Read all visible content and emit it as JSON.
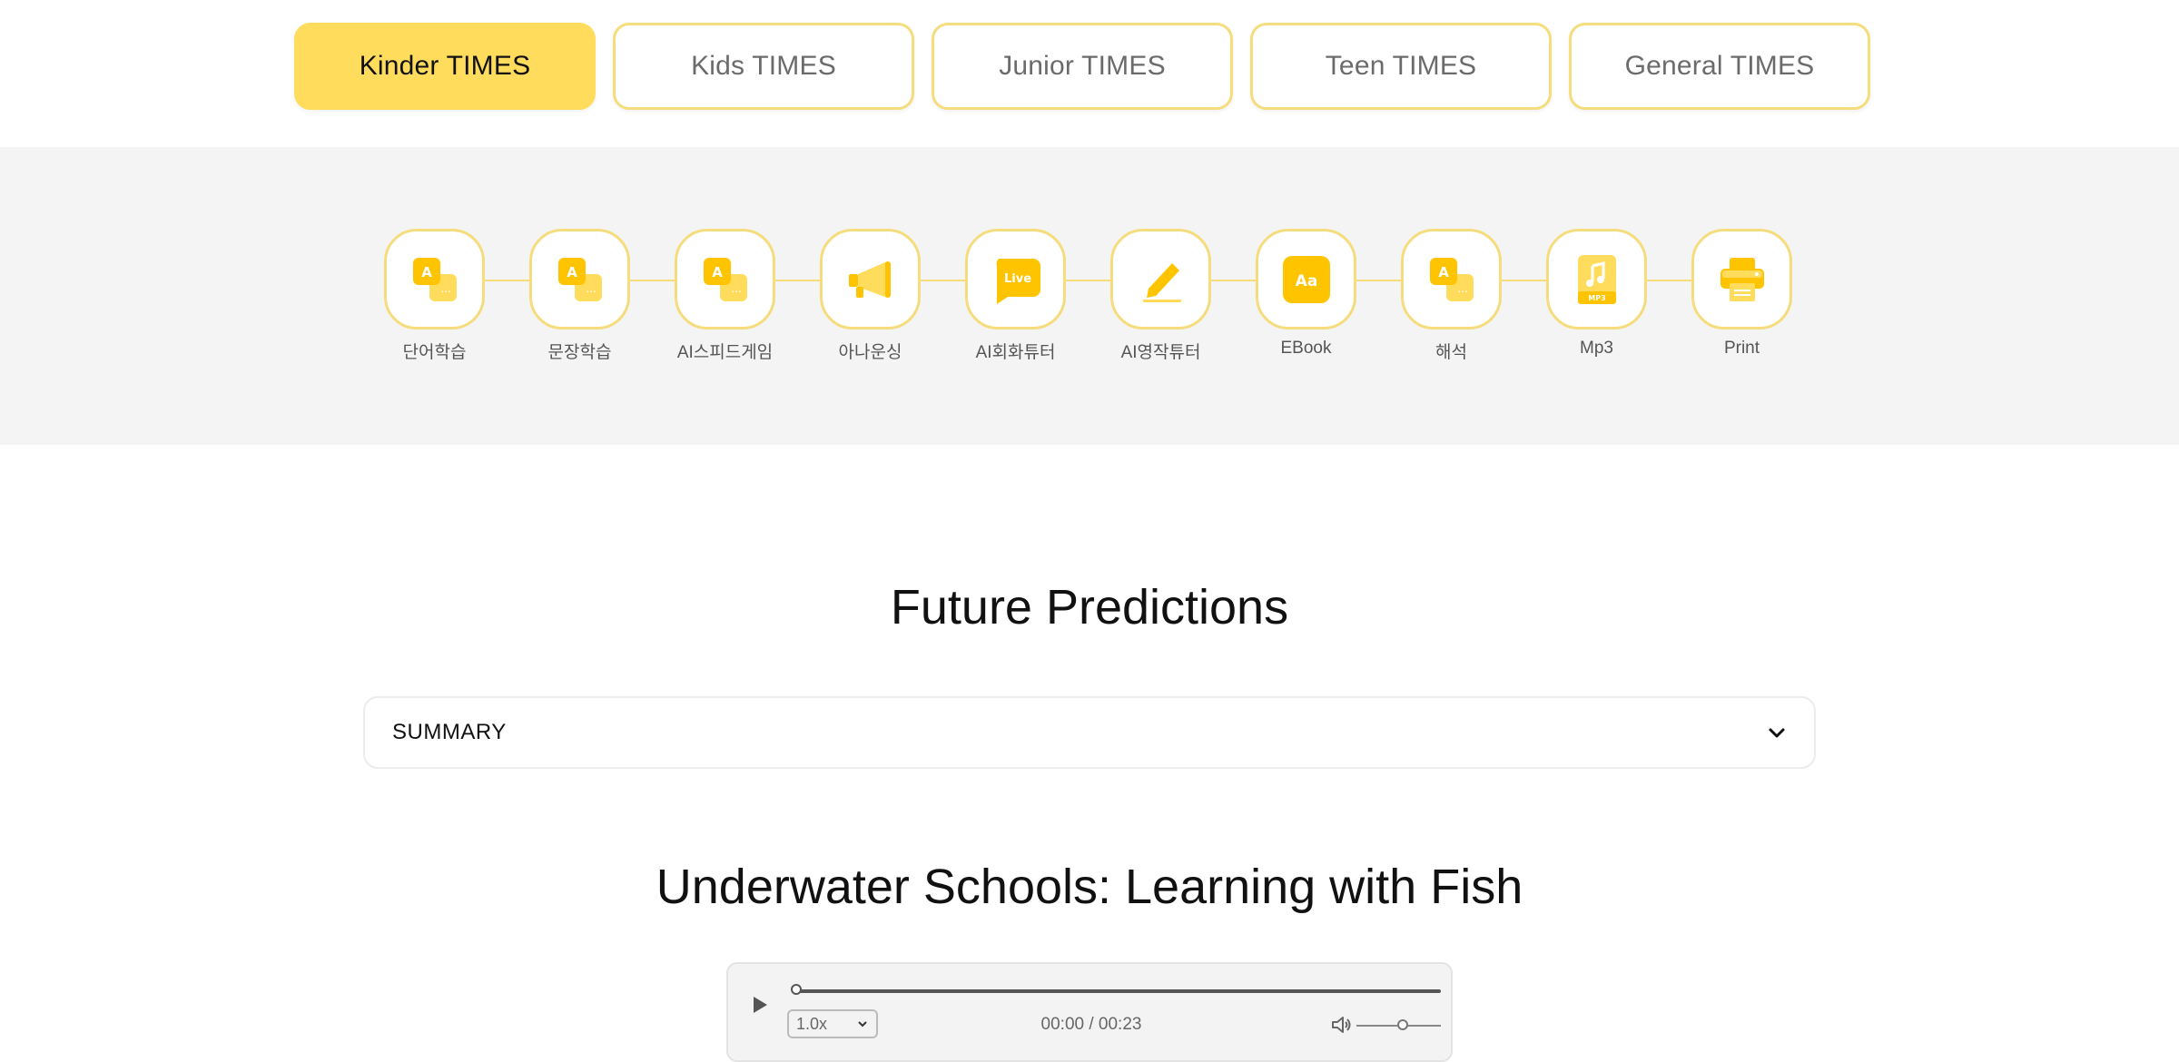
{
  "tabs": [
    {
      "label": "Kinder TIMES",
      "active": true
    },
    {
      "label": "Kids TIMES",
      "active": false
    },
    {
      "label": "Junior TIMES",
      "active": false
    },
    {
      "label": "Teen TIMES",
      "active": false
    },
    {
      "label": "General TIMES",
      "active": false
    }
  ],
  "tools": [
    {
      "label": "단어학습",
      "icon": "vocab-cards-icon"
    },
    {
      "label": "문장학습",
      "icon": "sentence-cards-icon"
    },
    {
      "label": "AI스피드게임",
      "icon": "speed-game-cards-icon"
    },
    {
      "label": "아나운싱",
      "icon": "megaphone-icon"
    },
    {
      "label": "AI회화튜터",
      "icon": "live-chat-icon",
      "badge": "Live"
    },
    {
      "label": "AI영작튜터",
      "icon": "pencil-icon"
    },
    {
      "label": "EBook",
      "icon": "ebook-icon",
      "badge": "Aa"
    },
    {
      "label": "해석",
      "icon": "translation-cards-icon"
    },
    {
      "label": "Mp3",
      "icon": "mp3-file-icon",
      "badge": "MP3"
    },
    {
      "label": "Print",
      "icon": "printer-icon"
    }
  ],
  "colors": {
    "accent": "#ffc400",
    "accent_light": "#ffdc5c",
    "border": "#f5dc7c",
    "band": "#f4f4f4"
  },
  "article": {
    "title": "Future Predictions"
  },
  "summary": {
    "label": "SUMMARY"
  },
  "story": {
    "title": "Underwater Schools: Learning with Fish"
  },
  "player": {
    "speed": "1.0x",
    "time": "00:00 / 00:23",
    "progress": 0,
    "volume_fraction": 0.55
  }
}
